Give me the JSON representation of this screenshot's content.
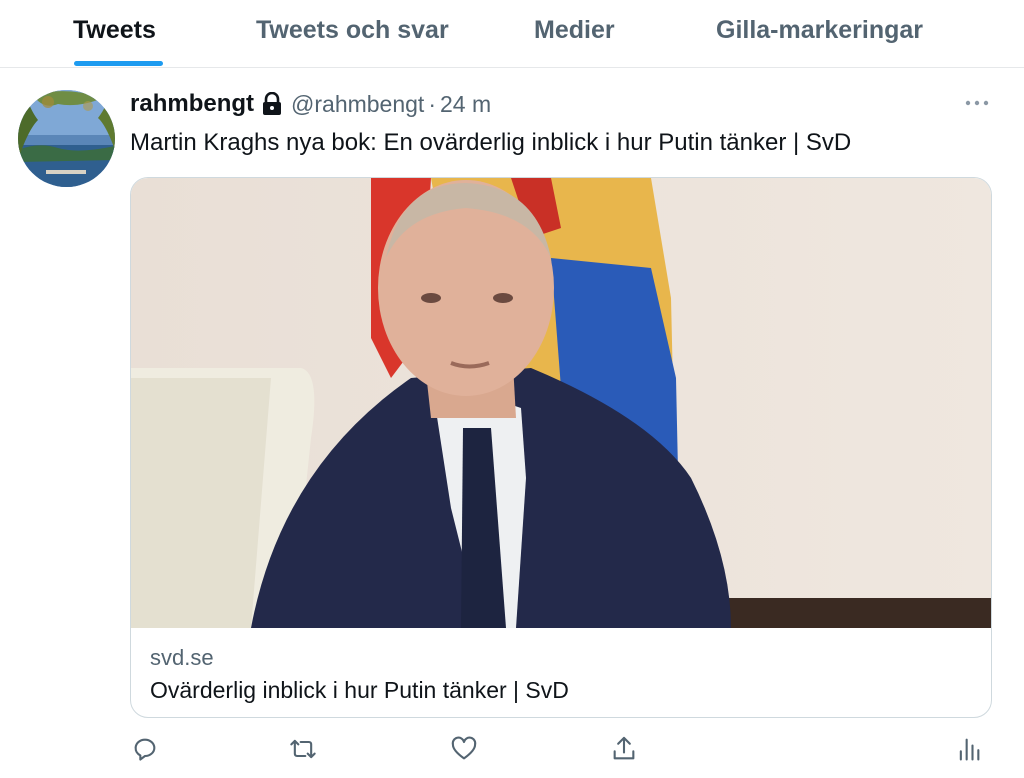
{
  "tabs": [
    {
      "label": "Tweets",
      "active": true
    },
    {
      "label": "Tweets och svar",
      "active": false
    },
    {
      "label": "Medier",
      "active": false
    },
    {
      "label": "Gilla-markeringar",
      "active": false
    }
  ],
  "tweet": {
    "display_name": "rahmbengt",
    "protected_icon": "lock-icon",
    "handle": "@rahmbengt",
    "separator": "·",
    "timestamp": "24 m",
    "text": "Martin Kraghs nya bok: En ovärderlig inblick i hur Putin tänker | SvD",
    "more_icon": "more-horizontal-icon"
  },
  "card": {
    "domain": "svd.se",
    "title": "Ovärderlig inblick i hur Putin tänker | SvD"
  },
  "actions": [
    {
      "icon": "reply-icon"
    },
    {
      "icon": "retweet-icon"
    },
    {
      "icon": "like-icon"
    },
    {
      "icon": "share-icon"
    },
    {
      "icon": "analytics-icon"
    }
  ],
  "colors": {
    "accent": "#1d9bf0",
    "text_primary": "#0f1419",
    "text_secondary": "#536471",
    "border": "#cfd9de"
  }
}
